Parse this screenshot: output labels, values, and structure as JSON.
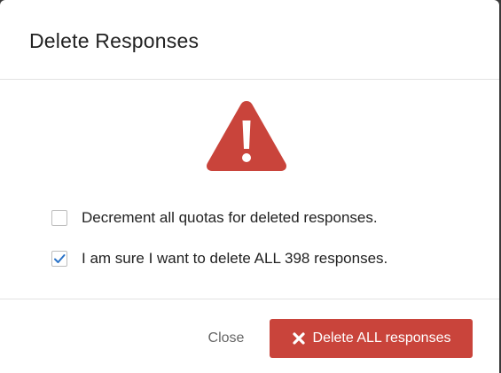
{
  "dialog": {
    "title": "Delete Responses",
    "accent_color": "#c9443b",
    "warning_icon": "exclamation-triangle-icon"
  },
  "options": [
    {
      "label": "Decrement all quotas for deleted responses.",
      "checked": false
    },
    {
      "label": "I am sure I want to delete ALL 398 responses.",
      "checked": true
    }
  ],
  "footer": {
    "close_label": "Close",
    "delete_label": "Delete ALL responses",
    "delete_icon": "x-icon"
  }
}
